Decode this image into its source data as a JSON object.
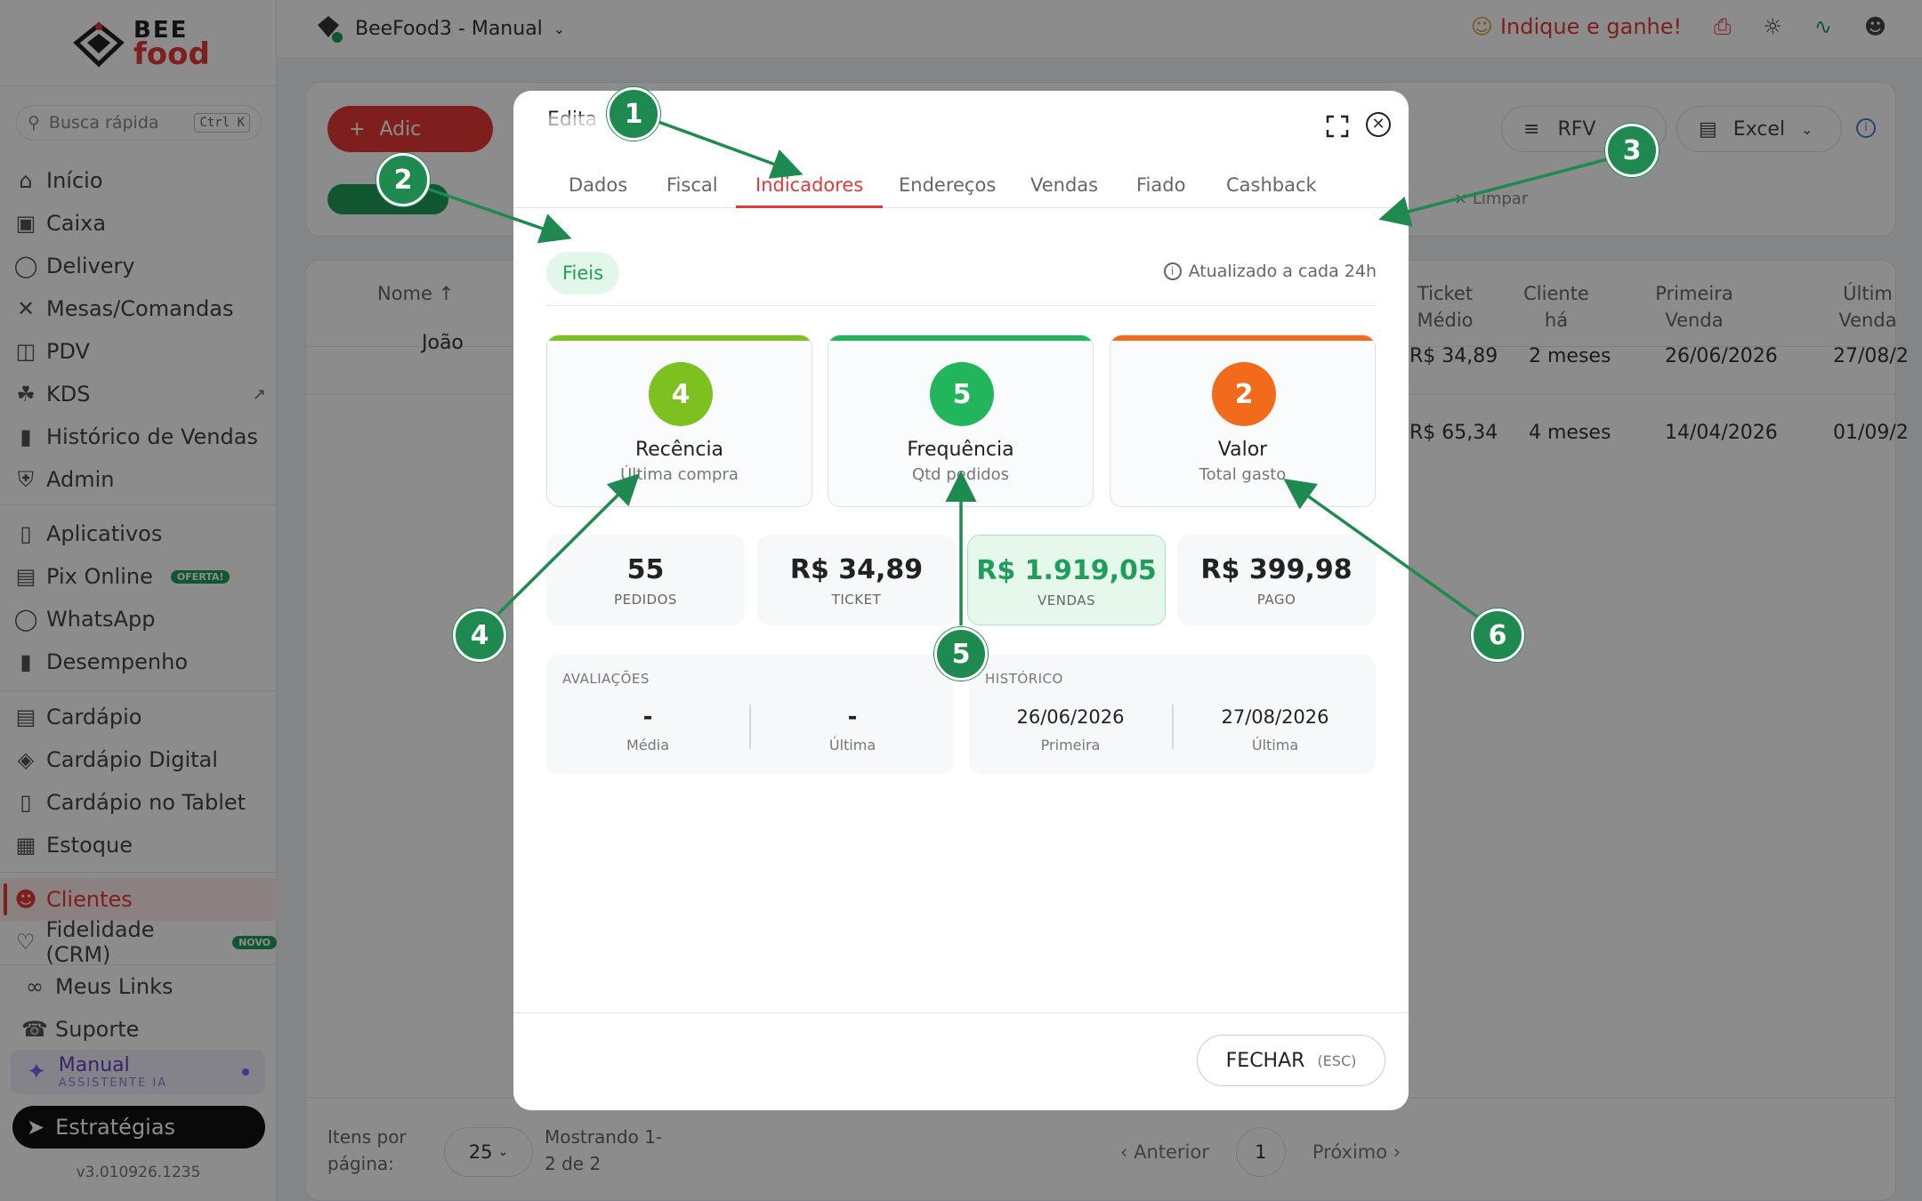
{
  "app": {
    "logo_bee": "BEE",
    "logo_food": "food",
    "store_name": "BeeFood3 - Manual",
    "indique": "Indique e ganhe!"
  },
  "sidebar": {
    "search_placeholder": "Busca rápida",
    "search_shortcut": "Ctrl K",
    "items": [
      {
        "label": "Início",
        "icon": "home-icon"
      },
      {
        "label": "Caixa",
        "icon": "cash-register-icon"
      },
      {
        "label": "Delivery",
        "icon": "bike-icon"
      },
      {
        "label": "Mesas/Comandas",
        "icon": "utensils-icon"
      },
      {
        "label": "PDV",
        "icon": "cart-icon"
      },
      {
        "label": "KDS",
        "icon": "chef-hat-icon"
      },
      {
        "label": "Histórico de Vendas",
        "icon": "bar-chart-icon"
      },
      {
        "label": "Admin",
        "icon": "shield-icon"
      },
      {
        "label": "Aplicativos",
        "icon": "smartphone-icon"
      },
      {
        "label": "Pix Online",
        "icon": "credit-card-icon",
        "badge": "OFERTA!"
      },
      {
        "label": "WhatsApp",
        "icon": "chat-icon"
      },
      {
        "label": "Desempenho",
        "icon": "bar-chart-icon"
      },
      {
        "label": "Cardápio",
        "icon": "book-icon"
      },
      {
        "label": "Cardápio Digital",
        "icon": "globe-icon"
      },
      {
        "label": "Cardápio no Tablet",
        "icon": "tablet-icon"
      },
      {
        "label": "Estoque",
        "icon": "boxes-icon"
      },
      {
        "label": "Clientes",
        "icon": "users-icon"
      },
      {
        "label": "Fidelidade (CRM)",
        "icon": "heart-icon",
        "badge": "NOVO"
      },
      {
        "label": "Meus Links",
        "icon": "link-icon"
      },
      {
        "label": "Suporte",
        "icon": "headset-icon"
      }
    ],
    "assistant_title": "Manual",
    "assistant_sub": "ASSISTENTE IA",
    "strategies": "Estratégias",
    "version": "v3.010926.1235"
  },
  "toolbar": {
    "add_label": "Adic",
    "rfv_label": "RFV",
    "excel_label": "Excel",
    "limpar": "Limpar"
  },
  "table": {
    "headers": [
      "Nome ↑",
      "Ticket Médio",
      "Cliente há",
      "Primeira Venda",
      "Últim Venda"
    ],
    "rows": [
      {
        "name": "João",
        "ticket": "R$ 34,89",
        "since": "2 meses",
        "first": "26/06/2026",
        "last": "27/08/2"
      },
      {
        "name": "",
        "ticket": "R$ 65,34",
        "since": "4 meses",
        "first": "14/04/2026",
        "last": "01/09/2"
      }
    ],
    "per_page_label": "Itens por página:",
    "per_page_value": "25",
    "showing": "Mostrando 1-2 de 2",
    "prev": "Anterior",
    "page": "1",
    "next": "Próximo"
  },
  "modal": {
    "title": "Edita",
    "tabs": [
      "Dados",
      "Fiscal",
      "Indicadores",
      "Endereços",
      "Vendas",
      "Fiado",
      "Cashback"
    ],
    "active_tab": "Indicadores",
    "segment": "Fieis",
    "updated": "Atualizado a cada 24h",
    "scores": [
      {
        "value": "4",
        "label": "Recência",
        "sub": "Última compra",
        "color": "#7cc11f"
      },
      {
        "value": "5",
        "label": "Frequência",
        "sub": "Qtd pedidos",
        "color": "#22b55c"
      },
      {
        "value": "2",
        "label": "Valor",
        "sub": "Total gasto",
        "color": "#f26b1d"
      }
    ],
    "metrics": [
      {
        "value": "55",
        "label": "PEDIDOS"
      },
      {
        "value": "R$ 34,89",
        "label": "TICKET"
      },
      {
        "value": "R$ 1.919,05",
        "label": "VENDAS"
      },
      {
        "value": "R$ 399,98",
        "label": "PAGO"
      }
    ],
    "reviews": {
      "caption": "AVALIAÇÕES",
      "avg": "-",
      "avg_label": "Média",
      "last": "-",
      "last_label": "Última"
    },
    "history": {
      "caption": "HISTÓRICO",
      "first": "26/06/2026",
      "first_label": "Primeira",
      "last": "27/08/2026",
      "last_label": "Última"
    },
    "close_label": "FECHAR",
    "close_shortcut": "(ESC)"
  },
  "annotations": [
    "1",
    "2",
    "3",
    "4",
    "5",
    "6"
  ]
}
